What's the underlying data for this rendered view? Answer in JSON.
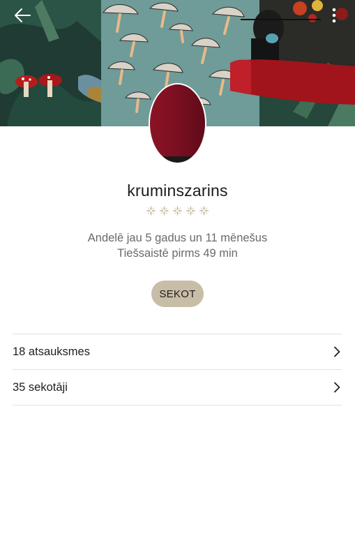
{
  "header": {
    "back_icon": "arrow-left-icon",
    "more_icon": "kebab-menu-icon"
  },
  "profile": {
    "username": "kruminszarins",
    "rating": {
      "value": 0,
      "max": 5,
      "star_color": "#c8bda6"
    },
    "member_since": "Andelē jau 5 gadus un 11 mēnešus",
    "last_online": "Tiešsaistē pirms 49 min",
    "avatar_color": "#7a0f21"
  },
  "actions": {
    "follow_label": "SEKOT",
    "follow_color": "#c8bda6"
  },
  "links": [
    {
      "label": "18 atsauksmes",
      "icon": "chevron-right-icon"
    },
    {
      "label": "35 sekotāji",
      "icon": "chevron-right-icon"
    }
  ]
}
